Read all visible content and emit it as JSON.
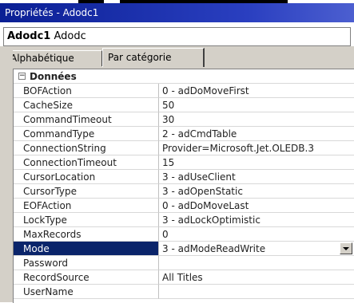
{
  "window": {
    "title": "Propriétés - Adodc1"
  },
  "object": {
    "name": "Adodc1",
    "type": "Adodc"
  },
  "tabs": [
    {
      "label": "Alphabétique",
      "active": false
    },
    {
      "label": "Par catégorie",
      "active": true
    }
  ],
  "category": {
    "label": "Données",
    "expander": "−"
  },
  "properties": [
    {
      "name": "BOFAction",
      "value": "0 - adDoMoveFirst"
    },
    {
      "name": "CacheSize",
      "value": "50"
    },
    {
      "name": "CommandTimeout",
      "value": "30"
    },
    {
      "name": "CommandType",
      "value": "2 - adCmdTable"
    },
    {
      "name": "ConnectionString",
      "value": "Provider=Microsoft.Jet.OLEDB.3"
    },
    {
      "name": "ConnectionTimeout",
      "value": "15"
    },
    {
      "name": "CursorLocation",
      "value": "3 - adUseClient"
    },
    {
      "name": "CursorType",
      "value": "3 - adOpenStatic"
    },
    {
      "name": "EOFAction",
      "value": "0 - adDoMoveLast"
    },
    {
      "name": "LockType",
      "value": "3 - adLockOptimistic"
    },
    {
      "name": "MaxRecords",
      "value": "0"
    },
    {
      "name": "Mode",
      "value": "3 - adModeReadWrite",
      "selected": true
    },
    {
      "name": "Password",
      "value": ""
    },
    {
      "name": "RecordSource",
      "value": "All Titles"
    },
    {
      "name": "UserName",
      "value": ""
    }
  ],
  "colors": {
    "titlebar": "#0a1f94",
    "selection": "#0a246a",
    "panel": "#d4d0c8"
  }
}
